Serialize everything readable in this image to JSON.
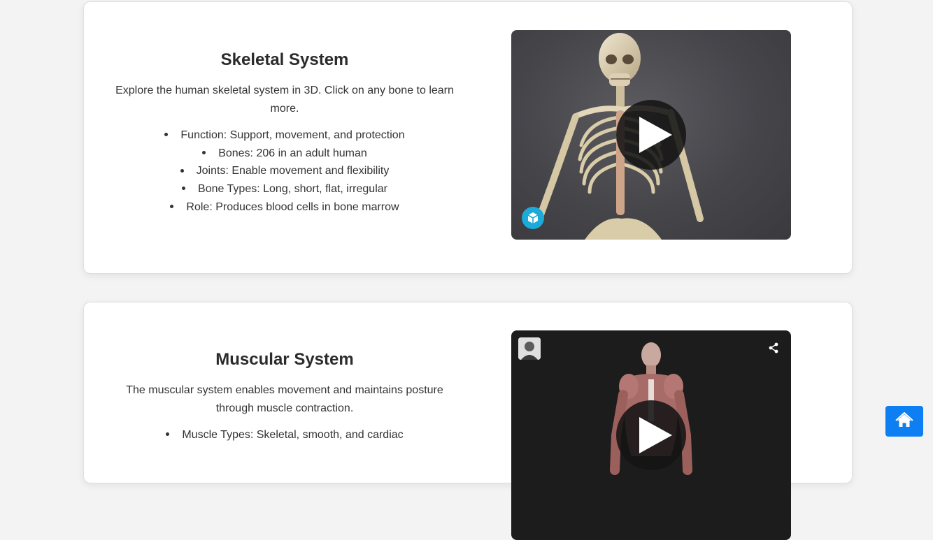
{
  "systems": [
    {
      "title": "Skeletal System",
      "description": "Explore the human skeletal system in 3D. Click on any bone to learn more.",
      "facts": [
        "Function: Support, movement, and protection",
        "Bones: 206 in an adult human",
        "Joints: Enable movement and flexibility",
        "Bone Types: Long, short, flat, irregular",
        "Role: Produces blood cells in bone marrow"
      ],
      "viewer": {
        "icons": [
          "play-icon",
          "sketchfab-logo-icon"
        ]
      }
    },
    {
      "title": "Muscular System",
      "description": "The muscular system enables movement and maintains posture through muscle contraction.",
      "facts": [
        "Muscle Types: Skeletal, smooth, and cardiac"
      ],
      "viewer": {
        "icons": [
          "author-avatar",
          "share-icon",
          "play-icon"
        ]
      }
    }
  ],
  "home_button": {
    "icon": "home-icon",
    "color": "#0d7ff2"
  },
  "colors": {
    "page_background": "#f3f3f4",
    "card_background": "#ffffff",
    "sketchfab_accent": "#1caad9"
  }
}
